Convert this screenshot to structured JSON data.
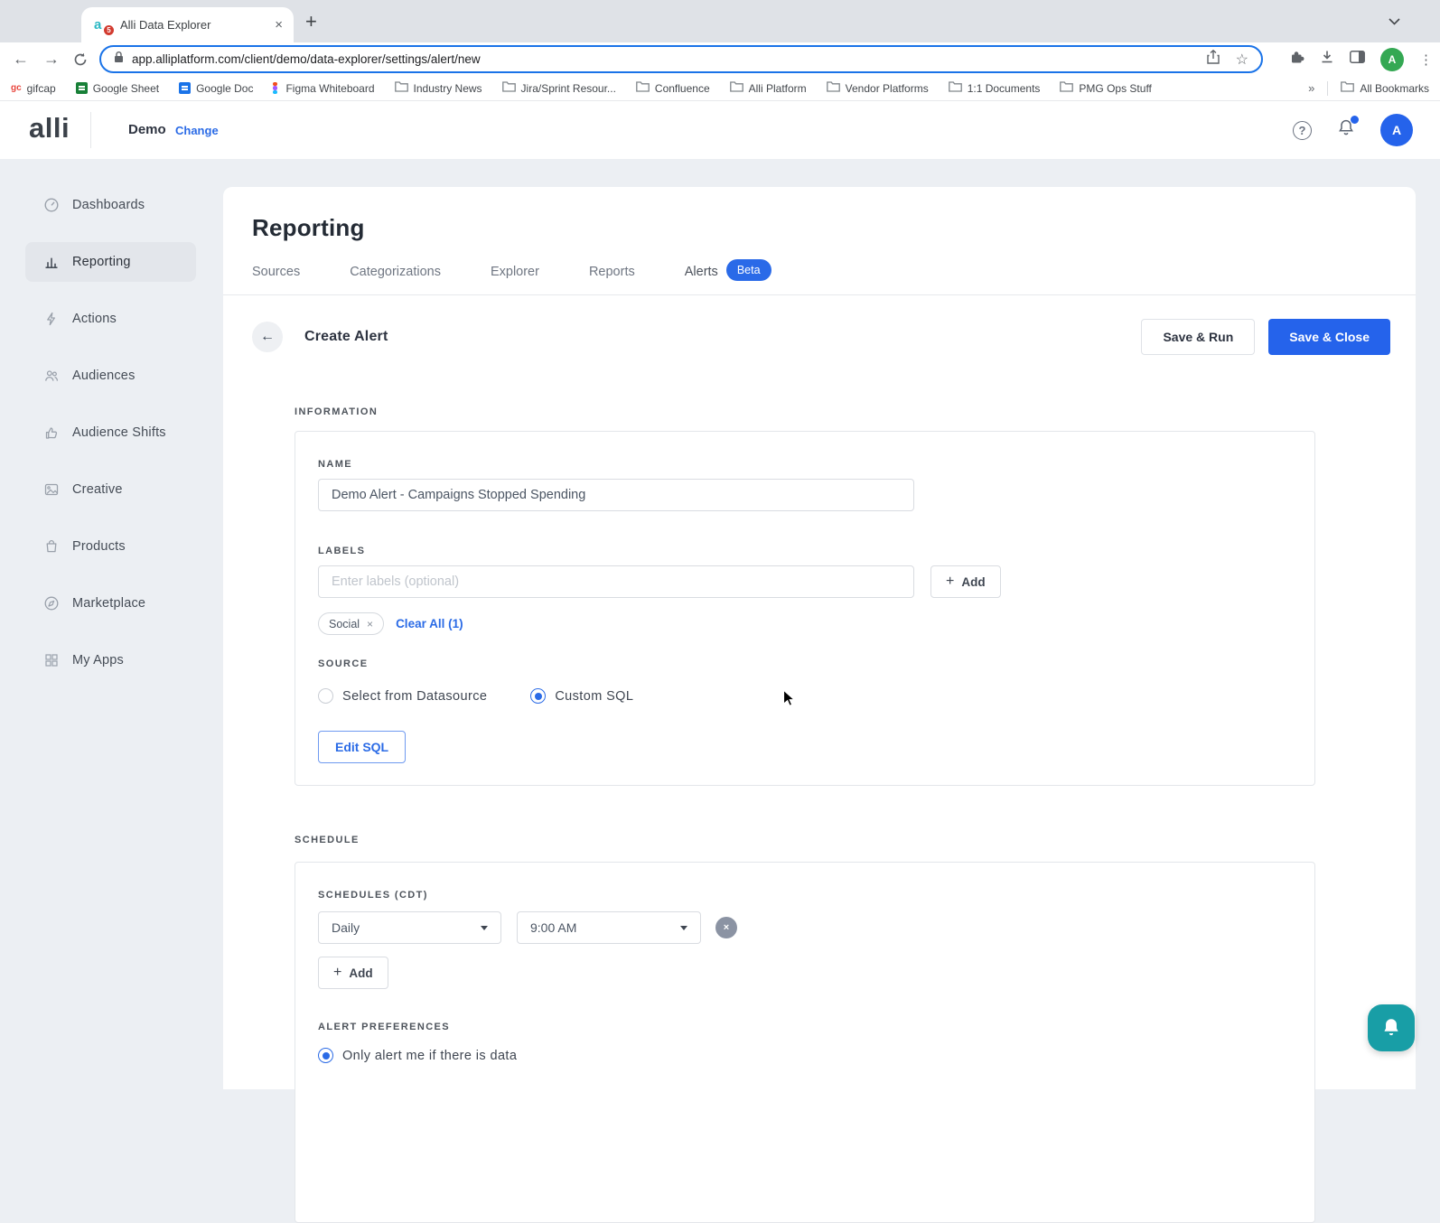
{
  "browser": {
    "tab_title": "Alli Data Explorer",
    "favicon_letter": "a",
    "favicon_badge": "5",
    "new_tab_label": "+",
    "close_label": "×",
    "url": "app.alliplatform.com/client/demo/data-explorer/settings/alert/new",
    "bookmarks": [
      {
        "label": "gifcap",
        "type": "gifcap",
        "icon_text": "gc"
      },
      {
        "label": "Google Sheet",
        "type": "sheet"
      },
      {
        "label": "Google Doc",
        "type": "doc"
      },
      {
        "label": "Figma Whiteboard",
        "type": "figma"
      },
      {
        "label": "Industry News",
        "type": "folder"
      },
      {
        "label": "Jira/Sprint Resour...",
        "type": "folder"
      },
      {
        "label": "Confluence",
        "type": "folder"
      },
      {
        "label": "Alli Platform",
        "type": "folder"
      },
      {
        "label": "Vendor Platforms",
        "type": "folder"
      },
      {
        "label": "1:1 Documents",
        "type": "folder"
      },
      {
        "label": "PMG Ops Stuff",
        "type": "folder"
      }
    ],
    "overflow_chevron": "»",
    "all_bookmarks_label": "All Bookmarks",
    "profile_initial": "A",
    "kebab": "⋮"
  },
  "app_header": {
    "logo_text": "alli",
    "client_name": "Demo",
    "change_label": "Change",
    "help_glyph": "?",
    "avatar_initial": "A"
  },
  "sidebar": {
    "items": [
      {
        "label": "Dashboards",
        "icon": "speedometer",
        "active": false
      },
      {
        "label": "Reporting",
        "icon": "bar-chart",
        "active": true
      },
      {
        "label": "Actions",
        "icon": "lightning",
        "active": false
      },
      {
        "label": "Audiences",
        "icon": "people",
        "active": false
      },
      {
        "label": "Audience Shifts",
        "icon": "thumbs-up",
        "active": false
      },
      {
        "label": "Creative",
        "icon": "image",
        "active": false
      },
      {
        "label": "Products",
        "icon": "bag",
        "active": false
      },
      {
        "label": "Marketplace",
        "icon": "compass",
        "active": false
      },
      {
        "label": "My Apps",
        "icon": "apps",
        "active": false
      }
    ]
  },
  "main": {
    "page_title": "Reporting",
    "tabs": [
      {
        "label": "Sources",
        "active": false
      },
      {
        "label": "Categorizations",
        "active": false
      },
      {
        "label": "Explorer",
        "active": false
      },
      {
        "label": "Reports",
        "active": false
      },
      {
        "label": "Alerts",
        "active": true,
        "badge": "Beta"
      }
    ],
    "header_bar": {
      "back_glyph": "←",
      "title": "Create Alert",
      "save_run_label": "Save & Run",
      "save_close_label": "Save & Close"
    },
    "information": {
      "section_label": "INFORMATION",
      "name_label": "NAME",
      "name_value": "Demo Alert - Campaigns Stopped Spending",
      "labels_label": "LABELS",
      "labels_placeholder": "Enter labels (optional)",
      "add_button_label": "Add",
      "label_chips": [
        {
          "text": "Social",
          "remove_glyph": "×"
        }
      ],
      "clear_all_label": "Clear All (1)",
      "source_label": "SOURCE",
      "source_options": [
        {
          "label": "Select from Datasource",
          "selected": false
        },
        {
          "label": "Custom SQL",
          "selected": true
        }
      ],
      "edit_sql_label": "Edit SQL"
    },
    "schedule": {
      "section_label": "SCHEDULE",
      "schedules_label": "SCHEDULES (CDT)",
      "frequency_value": "Daily",
      "time_value": "9:00 AM",
      "remove_glyph": "×",
      "add_button_label": "Add",
      "preferences_label": "ALERT PREFERENCES",
      "preference_options": [
        {
          "label": "Only alert me if there is data",
          "selected": true
        }
      ]
    }
  },
  "colors": {
    "accent_blue": "#2563eb",
    "link_blue": "#2b6be6",
    "beta_badge_blue": "#2a6ae8",
    "chat_teal": "#189ea6",
    "browser_profile_green": "#34a853",
    "page_background": "#eceff3",
    "active_item_gray": "#e3e6eb"
  }
}
